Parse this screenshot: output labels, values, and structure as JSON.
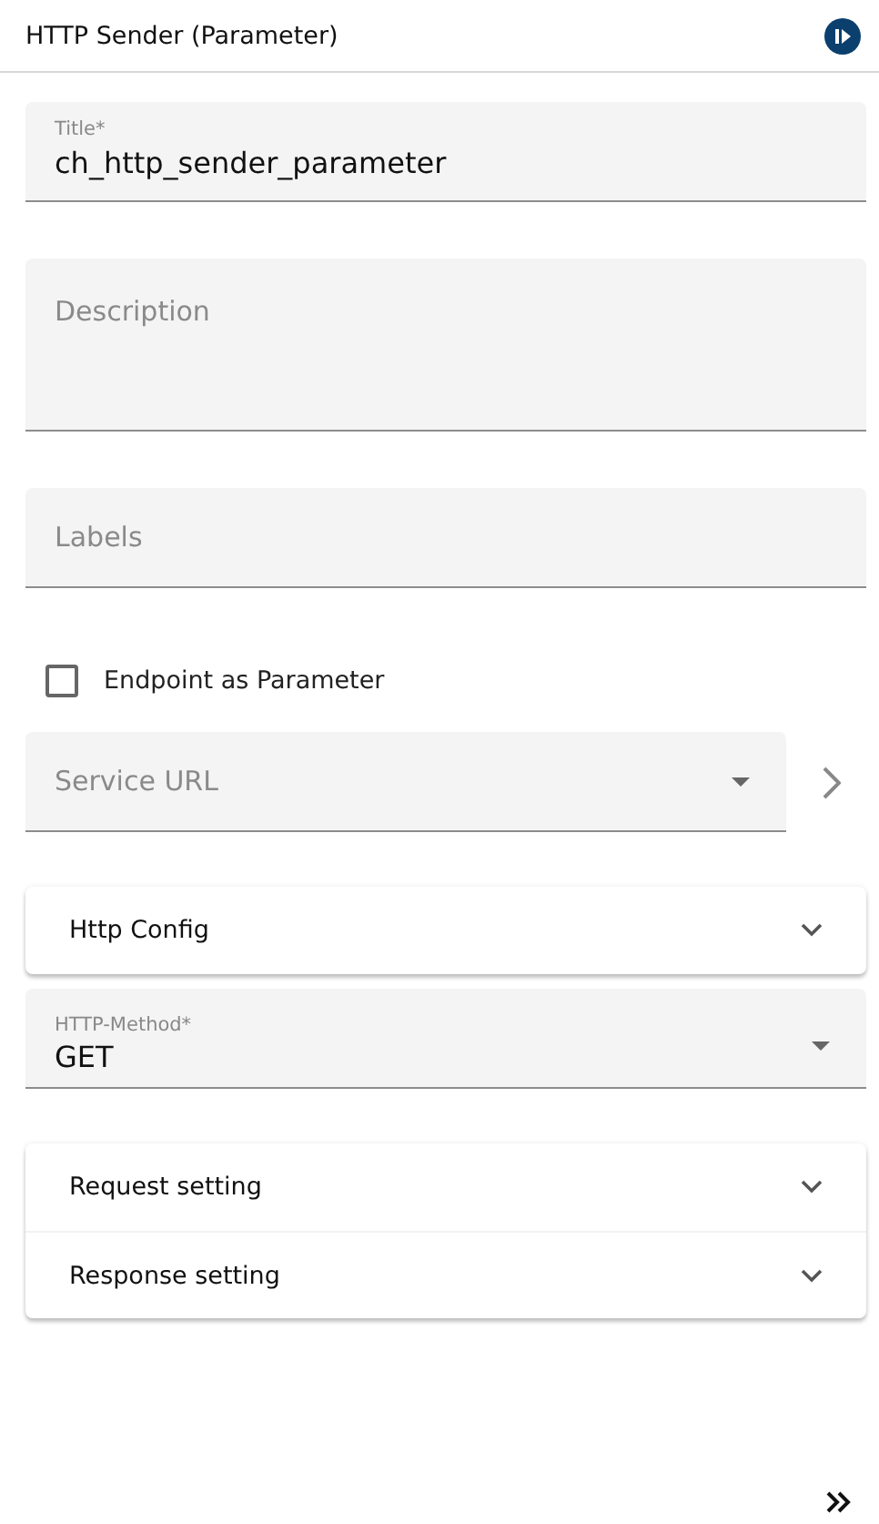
{
  "header": {
    "title": "HTTP Sender (Parameter)"
  },
  "fields": [
    {
      "kind": "text",
      "label": "Title*",
      "value": "ch_http_sender_parameter"
    },
    {
      "kind": "textarea",
      "placeholder": "Description"
    },
    {
      "kind": "text",
      "placeholder": "Labels"
    }
  ],
  "endpoint_checkbox": {
    "label": "Endpoint as Parameter",
    "checked": false
  },
  "service_url": {
    "placeholder": "Service URL"
  },
  "http_config": {
    "title": "Http Config",
    "expanded": false
  },
  "http_method": {
    "label": "HTTP-Method*",
    "value": "GET"
  },
  "settings": [
    {
      "title": "Request setting",
      "expanded": false
    },
    {
      "title": "Response setting",
      "expanded": false
    }
  ]
}
